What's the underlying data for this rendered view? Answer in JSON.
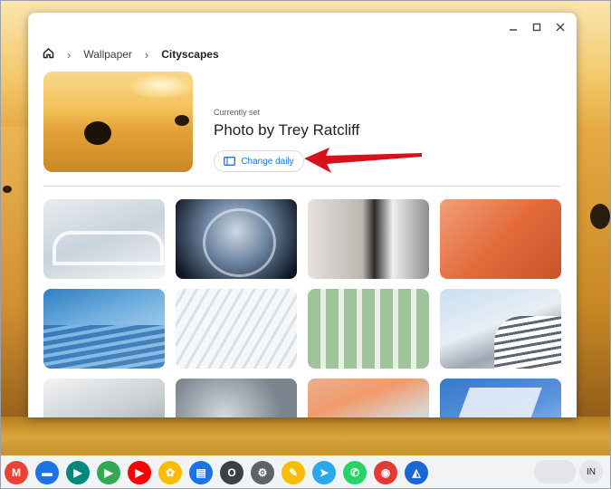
{
  "breadcrumb": {
    "root": "Wallpaper",
    "current": "Cityscapes"
  },
  "current_wallpaper": {
    "label": "Currently set",
    "title": "Photo by Trey Ratcliff",
    "change_daily_label": "Change daily"
  },
  "window_controls": {
    "minimize": "minimize-icon",
    "maximize": "maximize-icon",
    "close": "close-icon"
  },
  "wallpaper_tiles": [
    {
      "name": "white-curved-facade"
    },
    {
      "name": "glass-dome-roof"
    },
    {
      "name": "building-fire-escape"
    },
    {
      "name": "orange-building-stairs"
    },
    {
      "name": "blue-glass-facade"
    },
    {
      "name": "white-ribbed-structure"
    },
    {
      "name": "green-balconies"
    },
    {
      "name": "curved-white-tower"
    },
    {
      "name": "white-tiered-building"
    },
    {
      "name": "glass-tower-dome"
    },
    {
      "name": "orange-stair-railing"
    },
    {
      "name": "blue-sky-building"
    }
  ],
  "shelf": {
    "apps": [
      {
        "name": "gmail",
        "icon": "M",
        "color": "#ea4335"
      },
      {
        "name": "files",
        "icon": "▬",
        "color": "#1a73e8"
      },
      {
        "name": "meet",
        "icon": "▶",
        "color": "#00897b"
      },
      {
        "name": "play-store",
        "icon": "▶",
        "color": "#34a853"
      },
      {
        "name": "youtube",
        "icon": "▶",
        "color": "#ff0000"
      },
      {
        "name": "photos",
        "icon": "✿",
        "color": "#fbbc04"
      },
      {
        "name": "messages",
        "icon": "▤",
        "color": "#1a73e8"
      },
      {
        "name": "circle-app",
        "icon": "O",
        "color": "#3c4043"
      },
      {
        "name": "settings",
        "icon": "⚙",
        "color": "#5f6368"
      },
      {
        "name": "keep",
        "icon": "✎",
        "color": "#fbbc04"
      },
      {
        "name": "telegram",
        "icon": "➤",
        "color": "#29a9eb"
      },
      {
        "name": "whatsapp",
        "icon": "✆",
        "color": "#25d366"
      },
      {
        "name": "paint",
        "icon": "◉",
        "color": "#e53935"
      },
      {
        "name": "wallpaper-app",
        "icon": "◭",
        "color": "#1967d2"
      }
    ],
    "ime_label": "IN"
  }
}
